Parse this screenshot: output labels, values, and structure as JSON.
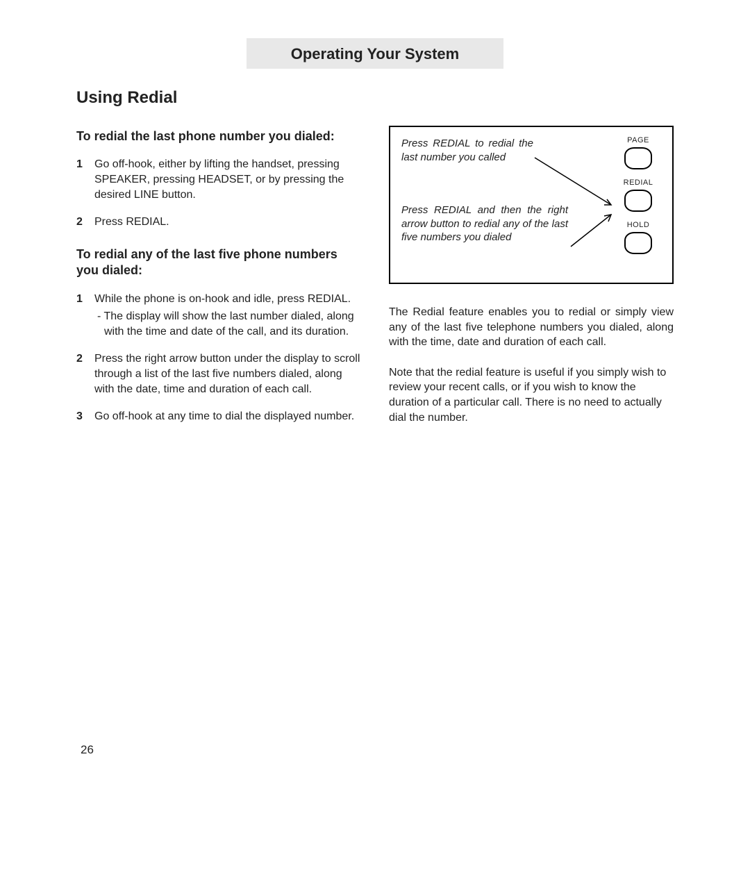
{
  "header": {
    "banner": "Operating Your System"
  },
  "title": "Using Redial",
  "left": {
    "sub1": "To redial the last phone num­ber you dialed:",
    "steps1": [
      "Go off-hook, either by lifting the handset, pressing SPEAKER, press­ing HEADSET, or by pressing the desired LINE button.",
      "Press REDIAL."
    ],
    "sub2": "To redial any of the last five phone numbers you dialed:",
    "steps2": [
      {
        "text": "While the phone is on-hook and idle, press REDIAL.",
        "sub": "- The display will show the last num­ber dialed, along with the time and date of the call, and its duration."
      },
      {
        "text": "Press the right arrow button under the display to scroll through a list of the last five numbers dialed, along with the date, time and duration of each call."
      },
      {
        "text": "Go off-hook at any time to dial the displayed number."
      }
    ]
  },
  "diagram": {
    "callout1": "Press REDIAL to redial the last num­ber you called",
    "callout2": "Press REDIAL and then the right arrow button to redial any of the last five numbers you dialed",
    "buttons": {
      "page": "PAGE",
      "redial": "REDIAL",
      "hold": "HOLD"
    }
  },
  "right": {
    "p1": "The Redial feature enables you to redial or sim­ply view any of the last five telephone numbers you dialed, along with the time, date and dura­tion of each call.",
    "p2": "Note that the redial feature is useful if you sim­ply wish to review your recent calls, or if you wish to know the duration of a particular call. There is no need to actually dial the number."
  },
  "page_number": "26"
}
